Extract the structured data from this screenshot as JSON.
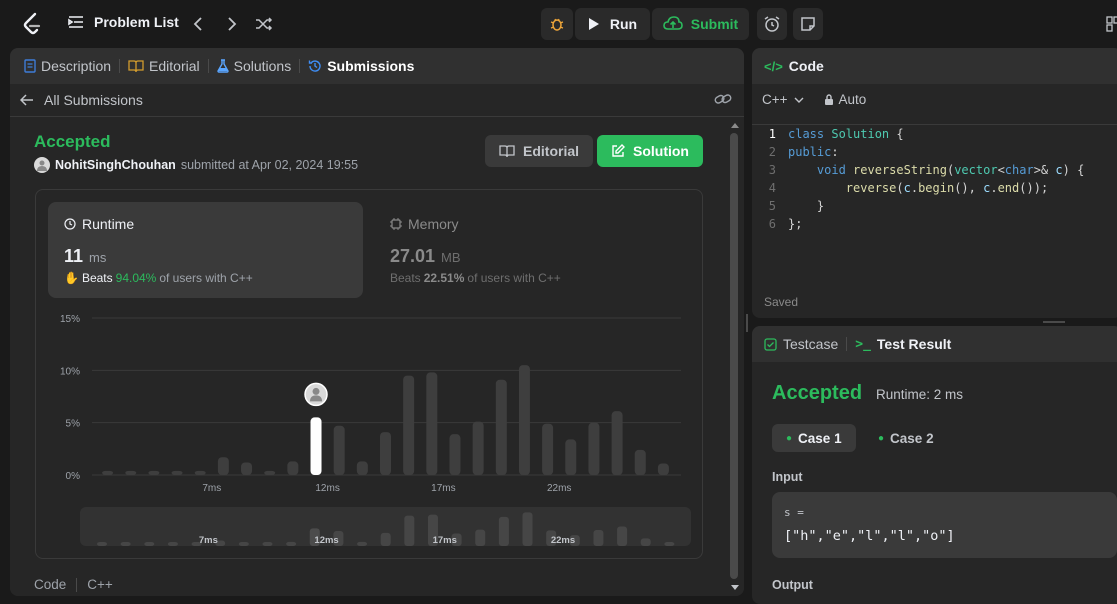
{
  "topbar": {
    "problem_list": "Problem List",
    "run": "Run",
    "submit": "Submit"
  },
  "left_panel": {
    "tabs": [
      {
        "label": "Description",
        "icon": "document-icon"
      },
      {
        "label": "Editorial",
        "icon": "book-icon"
      },
      {
        "label": "Solutions",
        "icon": "flask-icon"
      },
      {
        "label": "Submissions",
        "icon": "history-icon"
      }
    ],
    "all_submissions": "All Submissions",
    "status": "Accepted",
    "user": "NohitSinghChouhan",
    "submitted_text": "submitted at Apr 02, 2024 19:55",
    "editorial_btn": "Editorial",
    "solution_btn": "Solution",
    "runtime": {
      "title": "Runtime",
      "value": "11",
      "unit": "ms",
      "beats_label": "Beats",
      "beats_pct": "94.04%",
      "beats_suffix": "of users with C++"
    },
    "memory": {
      "title": "Memory",
      "value": "27.01",
      "unit": "MB",
      "beats_label": "Beats",
      "beats_pct": "22.51%",
      "beats_suffix": "of users with C++"
    },
    "code_label": "Code",
    "lang_label": "C++"
  },
  "chart_data": {
    "type": "bar",
    "title": "",
    "xlabel": "",
    "ylabel": "",
    "ylim": [
      0,
      15
    ],
    "y_ticks": [
      "15%",
      "10%",
      "5%",
      "0%"
    ],
    "x_ticks": [
      "7ms",
      "12ms",
      "17ms",
      "22ms"
    ],
    "values": [
      0.4,
      0.4,
      0.4,
      0.4,
      0.4,
      1.7,
      1.2,
      0.4,
      1.3,
      5.5,
      4.7,
      1.3,
      4.1,
      9.5,
      9.8,
      3.9,
      5.1,
      9.1,
      10.5,
      4.9,
      3.4,
      5.0,
      6.1,
      2.4,
      1.1
    ],
    "highlight_index": 9,
    "bar_color": "#3e3e3e",
    "highlight_color": "#ffffff"
  },
  "code_panel": {
    "title": "Code",
    "language": "C++",
    "mode": "Auto",
    "saved": "Saved",
    "lines": [
      "1",
      "2",
      "3",
      "4",
      "5",
      "6"
    ]
  },
  "result_panel": {
    "tab_testcase": "Testcase",
    "tab_result": "Test Result",
    "status": "Accepted",
    "runtime": "Runtime: 2 ms",
    "case1": "Case 1",
    "case2": "Case 2",
    "input_label": "Input",
    "var_name": "s =",
    "var_value": "[\"h\",\"e\",\"l\",\"l\",\"o\"]",
    "output_label": "Output"
  }
}
